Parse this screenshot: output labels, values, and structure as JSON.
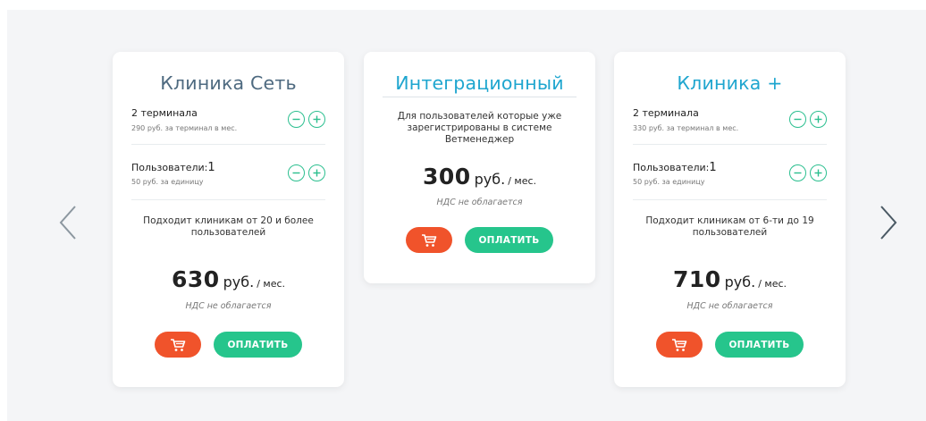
{
  "colors": {
    "accent_blue": "#1fa6cf",
    "title_gray": "#4e6a80",
    "pay_green": "#26c58c",
    "cart_orange": "#f0532b",
    "stepper_green": "#2bbf8f"
  },
  "nav": {
    "prev_icon": "chevron-left-icon",
    "next_icon": "chevron-right-icon"
  },
  "cards": [
    {
      "title": "Клиника Сеть",
      "terminals": {
        "label": "2 терминала",
        "sub": "290 руб. за терминал в мес."
      },
      "users": {
        "label": "Пользователи:",
        "count": "1",
        "sub": "50 руб. за единицу"
      },
      "description": "Подходит клиникам от 20 и более пользователей",
      "price": {
        "amount": "630",
        "currency": "руб.",
        "period": "/ мес."
      },
      "vat": "НДС не облагается",
      "pay_label": "ОПЛАТИТЬ"
    },
    {
      "title": "Интеграционный",
      "description": "Для пользователей которые уже зарегистрированы в системе Ветменеджер",
      "price": {
        "amount": "300",
        "currency": "руб.",
        "period": "/ мес."
      },
      "vat": "НДС не облагается",
      "pay_label": "ОПЛАТИТЬ"
    },
    {
      "title": "Клиника +",
      "terminals": {
        "label": "2 терминала",
        "sub": "330 руб. за терминал в мес."
      },
      "users": {
        "label": "Пользователи:",
        "count": "1",
        "sub": "50 руб. за единицу"
      },
      "description": "Подходит клиникам от 6-ти до 19 пользователей",
      "price": {
        "amount": "710",
        "currency": "руб.",
        "period": "/ мес."
      },
      "vat": "НДС не облагается",
      "pay_label": "ОПЛАТИТЬ"
    }
  ]
}
